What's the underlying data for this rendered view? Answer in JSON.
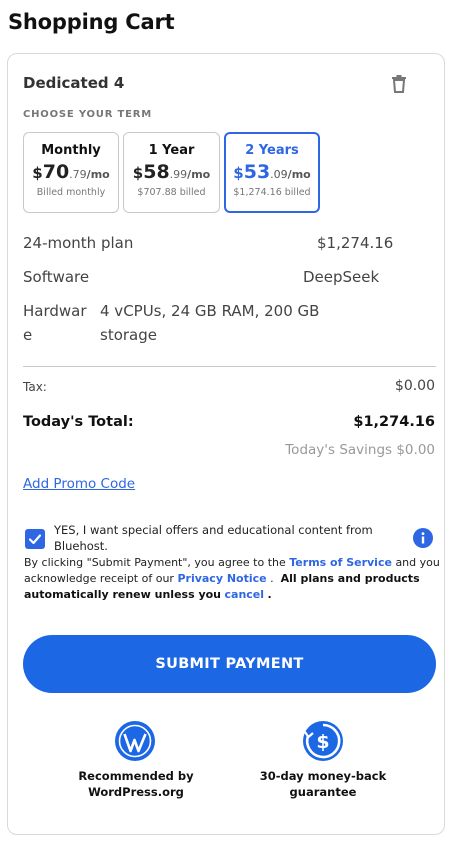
{
  "page": {
    "title": "Shopping Cart"
  },
  "product": {
    "name": "Dedicated 4"
  },
  "term_section": {
    "label": "CHOOSE YOUR TERM"
  },
  "terms": [
    {
      "name": "Monthly",
      "currency": "$",
      "price_main": "70",
      "price_cents": ".79",
      "unit": "/mo",
      "billed": "Billed monthly",
      "selected": false
    },
    {
      "name": "1 Year",
      "currency": "$",
      "price_main": "58",
      "price_cents": ".99",
      "unit": "/mo",
      "billed": "$707.88 billed",
      "selected": false
    },
    {
      "name": "2 Years",
      "currency": "$",
      "price_main": "53",
      "price_cents": ".09",
      "unit": "/mo",
      "billed": "$1,274.16 billed",
      "selected": true
    }
  ],
  "details": {
    "plan_label": "24-month plan",
    "plan_value": "$1,274.16",
    "software_label": "Software",
    "software_value": "DeepSeek",
    "hardware_label_1": "Hardwar",
    "hardware_label_2": "e",
    "hardware_value_1": "4 vCPUs, 24 GB RAM, 200 GB",
    "hardware_value_2": "storage"
  },
  "summary": {
    "tax_label": "Tax:",
    "tax_value": "$0.00",
    "total_label": "Today's Total:",
    "total_value": "$1,274.16",
    "savings": "Today's Savings $0.00"
  },
  "promo": {
    "label": "Add Promo Code"
  },
  "consent": {
    "checked": true,
    "text": "YES, I want special offers and educational content from Bluehost."
  },
  "legal": {
    "part1": "By clicking \"Submit Payment\", you agree to the",
    "tos": "Terms of Service",
    "part2": "and you acknowledge receipt of our",
    "privacy": "Privacy Notice",
    "part3": ".",
    "bold": "All plans and products automatically renew unless you",
    "cancel": "cancel",
    "part4": "."
  },
  "submit": {
    "label": "SUBMIT PAYMENT"
  },
  "badges": [
    {
      "icon": "wordpress-icon",
      "line1": "Recommended by",
      "line2": "WordPress.org"
    },
    {
      "icon": "money-back-icon",
      "line1": "30-day money-back",
      "line2": "guarantee"
    }
  ],
  "colors": {
    "accent": "#2e66e3",
    "button": "#1b67e4",
    "muted": "#999999"
  }
}
